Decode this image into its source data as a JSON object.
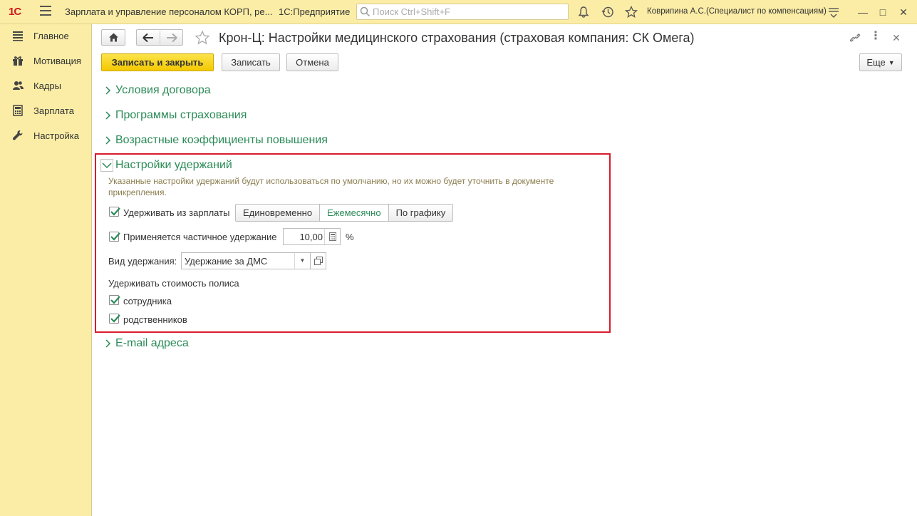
{
  "app": {
    "logo": "1С",
    "title": "Зарплата и управление персоналом КОРП, ре...",
    "platform": "1С:Предприятие",
    "search_placeholder": "Поиск Ctrl+Shift+F",
    "user": "Коврипина А.С.(Специалист по компенсациям)"
  },
  "sidebar": {
    "items": [
      {
        "label": "Главное",
        "icon": "menu-lines-icon"
      },
      {
        "label": "Мотивация",
        "icon": "gift-icon"
      },
      {
        "label": "Кадры",
        "icon": "people-icon"
      },
      {
        "label": "Зарплата",
        "icon": "calculator-icon"
      },
      {
        "label": "Настройка",
        "icon": "wrench-icon"
      }
    ]
  },
  "form": {
    "title": "Крон-Ц: Настройки медицинского страхования (страховая компания: СК Омега)",
    "toolbar": {
      "save_close": "Записать и закрыть",
      "save": "Записать",
      "cancel": "Отмена",
      "more": "Еще"
    },
    "groups": {
      "contract": "Условия договора",
      "programs": "Программы страхования",
      "age_coeffs": "Возрастные коэффициенты повышения",
      "deductions": "Настройки удержаний",
      "email": "E-mail адреса"
    },
    "deductions": {
      "hint": "Указанные настройки удержаний будут использоваться по умолчанию, но их можно будет уточнить в документе прикрепления.",
      "withhold_salary_label": "Удерживать из зарплаты",
      "withhold_salary_checked": true,
      "modes": [
        "Единовременно",
        "Ежемесячно",
        "По графику"
      ],
      "selected_mode": "Ежемесячно",
      "partial_label": "Применяется частичное удержание",
      "partial_checked": true,
      "partial_value": "10,00",
      "percent_sign": "%",
      "kind_label": "Вид удержания:",
      "kind_value": "Удержание за ДМС",
      "policy_cost_label": "Удерживать стоимость полиса",
      "employee_label": "сотрудника",
      "employee_checked": true,
      "relatives_label": "родственников",
      "relatives_checked": true
    }
  },
  "colors": {
    "accent_green": "#2b8b57",
    "panel_yellow": "#fbeda6",
    "primary_button": "#f4c901",
    "highlight_red": "#d91c2a"
  }
}
